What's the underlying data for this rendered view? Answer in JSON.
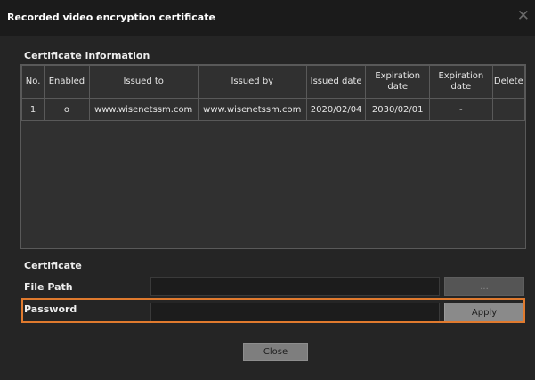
{
  "dialog": {
    "title": "Recorded video encryption certificate",
    "close_glyph": "✕"
  },
  "certificate_info": {
    "heading": "Certificate information",
    "columns": [
      "No.",
      "Enabled",
      "Issued to",
      "Issued by",
      "Issued date",
      "Expiration date",
      "Expiration date",
      "Delete"
    ],
    "rows": [
      [
        "1",
        "o",
        "www.wisenetssm.com",
        "www.wisenetssm.com",
        "2020/02/04",
        "2030/02/01",
        "-",
        ""
      ]
    ]
  },
  "certificate": {
    "heading": "Certificate",
    "file_path_label": "File Path",
    "file_path_value": "",
    "browse_label": "...",
    "password_label": "Password",
    "password_value": "",
    "apply_label": "Apply"
  },
  "footer": {
    "close_label": "Close"
  },
  "colors": {
    "highlight": "#e07a2e",
    "dialog_bg": "#252525",
    "title_bg": "#1b1b1b"
  }
}
